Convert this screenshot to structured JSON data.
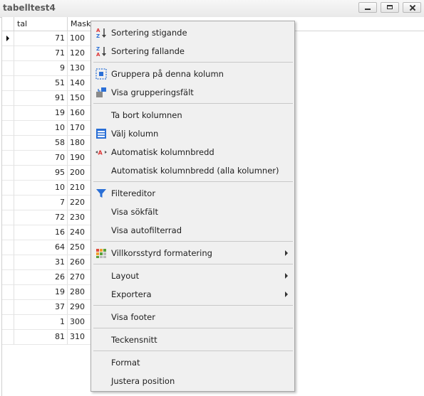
{
  "window": {
    "title": "tabelltest4"
  },
  "grid": {
    "columns": [
      "tal",
      "Maskin"
    ],
    "rows": [
      {
        "tal": "71",
        "maskin": "100"
      },
      {
        "tal": "71",
        "maskin": "120"
      },
      {
        "tal": "9",
        "maskin": "130"
      },
      {
        "tal": "51",
        "maskin": "140"
      },
      {
        "tal": "91",
        "maskin": "150"
      },
      {
        "tal": "19",
        "maskin": "160"
      },
      {
        "tal": "10",
        "maskin": "170"
      },
      {
        "tal": "58",
        "maskin": "180"
      },
      {
        "tal": "70",
        "maskin": "190"
      },
      {
        "tal": "95",
        "maskin": "200"
      },
      {
        "tal": "10",
        "maskin": "210"
      },
      {
        "tal": "7",
        "maskin": "220"
      },
      {
        "tal": "72",
        "maskin": "230"
      },
      {
        "tal": "16",
        "maskin": "240"
      },
      {
        "tal": "64",
        "maskin": "250"
      },
      {
        "tal": "31",
        "maskin": "260"
      },
      {
        "tal": "26",
        "maskin": "270"
      },
      {
        "tal": "19",
        "maskin": "280"
      },
      {
        "tal": "37",
        "maskin": "290"
      },
      {
        "tal": "1",
        "maskin": "300"
      },
      {
        "tal": "81",
        "maskin": "310"
      }
    ]
  },
  "menu": {
    "sort_asc": "Sortering stigande",
    "sort_desc": "Sortering fallande",
    "group_by": "Gruppera på denna kolumn",
    "show_group_field": "Visa grupperingsfält",
    "remove_column": "Ta bort kolumnen",
    "choose_column": "Välj kolumn",
    "auto_width": "Automatisk kolumnbredd",
    "auto_width_all": "Automatisk kolumnbredd (alla kolumner)",
    "filter_editor": "Filtereditor",
    "show_search": "Visa sökfält",
    "show_autofilter": "Visa autofilterrad",
    "conditional_format": "Villkorsstyrd formatering",
    "layout": "Layout",
    "export": "Exportera",
    "show_footer": "Visa footer",
    "font": "Teckensnitt",
    "format": "Format",
    "adjust_position": "Justera position"
  }
}
